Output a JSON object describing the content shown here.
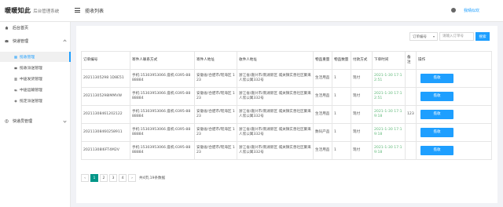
{
  "header": {
    "logo_mark": "暖暖知此",
    "logo_sub": "后台管理系统",
    "page_title": "揽收列表",
    "user_name": "我晴似欢"
  },
  "sidebar": {
    "items": [
      {
        "label": "后台首页",
        "icon": "home-icon"
      },
      {
        "label": "快递管理",
        "icon": "mail-icon",
        "expanded": true
      },
      {
        "label": "快递员管理",
        "icon": "user-circle-icon"
      }
    ],
    "sub_items": [
      {
        "label": "揽收管理",
        "active": true
      },
      {
        "label": "揽收派送管理",
        "active": false
      },
      {
        "label": "中途发货管理",
        "active": false
      },
      {
        "label": "中途运输管理",
        "active": false
      },
      {
        "label": "揽定派送管理",
        "active": false
      }
    ]
  },
  "filter": {
    "select_label": "订单编号",
    "search_placeholder": "请输入订单号",
    "search_button": "搜索"
  },
  "table": {
    "headers": [
      "订单编号",
      "寄件人联系方式",
      "寄件人地址",
      "收件人地址",
      "物品重量",
      "物品数量",
      "付款方式",
      "下单时间",
      "备注",
      "操作"
    ],
    "action_label": "揽收",
    "rows": [
      {
        "order_no": "20211305298 1D8E51",
        "sender_contact": "手机:15303953066 座机:0395-8888884",
        "sender_addr": "安徽省/合肥市/瑶海区 123",
        "receiver_addr": "浙江省/嘉兴市/南湖新区 城关镇实善社区聚来人欣公寓332号",
        "item_type": "生活用品",
        "qty": "1",
        "payment": "现付",
        "order_time": "2021-1-30 17:12:51",
        "remark": ""
      },
      {
        "order_no": "20211305298lMMVW",
        "sender_contact": "手机:15303953066 座机:0395-8888884",
        "sender_addr": "安徽省/合肥市/瑶海区 123",
        "receiver_addr": "浙江省/嘉兴市/南湖新区 城关镇实善社区聚来人欣公寓332号",
        "item_type": "生活用品",
        "qty": "1",
        "payment": "现付",
        "order_time": "2021-1-30 17:12:51",
        "remark": ""
      },
      {
        "order_no": "20211308461202122",
        "sender_contact": "手机:15303953066 座机:0395-8888884",
        "sender_addr": "安徽省/合肥市/瑶海区 123",
        "receiver_addr": "浙江省/嘉兴市/南湖新区 城关镇实善社区聚来人欣公寓332号",
        "item_type": "生活用品",
        "qty": "1",
        "payment": "现付",
        "order_time": "2021-1-30 17:19:18",
        "remark": "123"
      },
      {
        "order_no": "20211308460258911",
        "sender_contact": "手机:15303953066 座机:0395-8888884",
        "sender_addr": "安徽省/合肥市/瑶海区 123",
        "receiver_addr": "浙江省/嘉兴市/南湖新区 城关镇实善社区聚来人欣公寓332号",
        "item_type": "数码产品",
        "qty": "1",
        "payment": "现付",
        "order_time": "2021-1-30 17:19:18",
        "remark": ""
      },
      {
        "order_no": "20211308l6FT4M2V",
        "sender_contact": "手机:15303953066 座机:0395-8888884",
        "sender_addr": "安徽省/合肥市/瑶海区 123",
        "receiver_addr": "浙江省/嘉兴市/南湖新区 城关镇实善社区聚来人欣公寓332号",
        "item_type": "生活用品",
        "qty": "1",
        "payment": "现付",
        "order_time": "2021-1-30 17:19:18",
        "remark": ""
      }
    ]
  },
  "pagination": {
    "prev": "‹",
    "pages": [
      "1",
      "2",
      "3",
      "4"
    ],
    "current": "1",
    "next": "›",
    "total_text": "共4页,19条数据"
  },
  "colors": {
    "accent": "#1e9fff",
    "pager_active": "#009688",
    "time_green": "#5fb878"
  }
}
